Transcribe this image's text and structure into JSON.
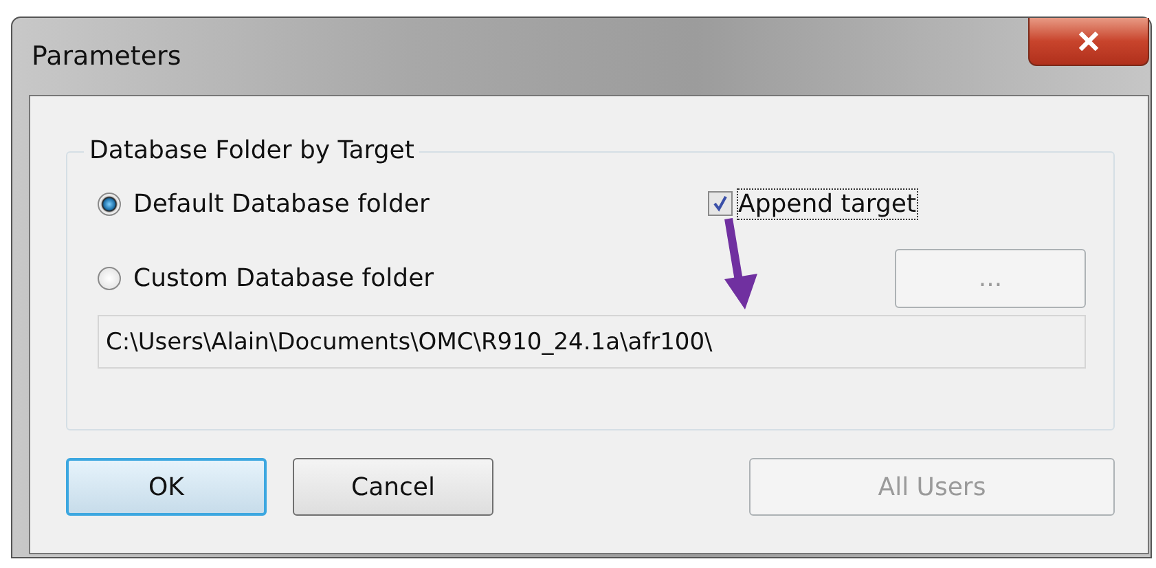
{
  "window": {
    "title": "Parameters"
  },
  "group": {
    "title": "Database Folder by Target",
    "options": [
      {
        "label": "Default Database folder",
        "selected": true
      },
      {
        "label": "Custom Database folder",
        "selected": false
      }
    ],
    "append_target": {
      "label": "Append target",
      "checked": true,
      "focused": true
    },
    "browse_button": {
      "label": "...",
      "disabled": true
    },
    "path_field": {
      "value": "C:\\Users\\Alain\\Documents\\OMC\\R910_24.1a\\afr100\\",
      "disabled": true
    }
  },
  "buttons": [
    {
      "label": "OK",
      "default": true,
      "disabled": false
    },
    {
      "label": "Cancel",
      "default": false,
      "disabled": false
    },
    {
      "label": "All Users",
      "default": false,
      "disabled": true
    }
  ]
}
